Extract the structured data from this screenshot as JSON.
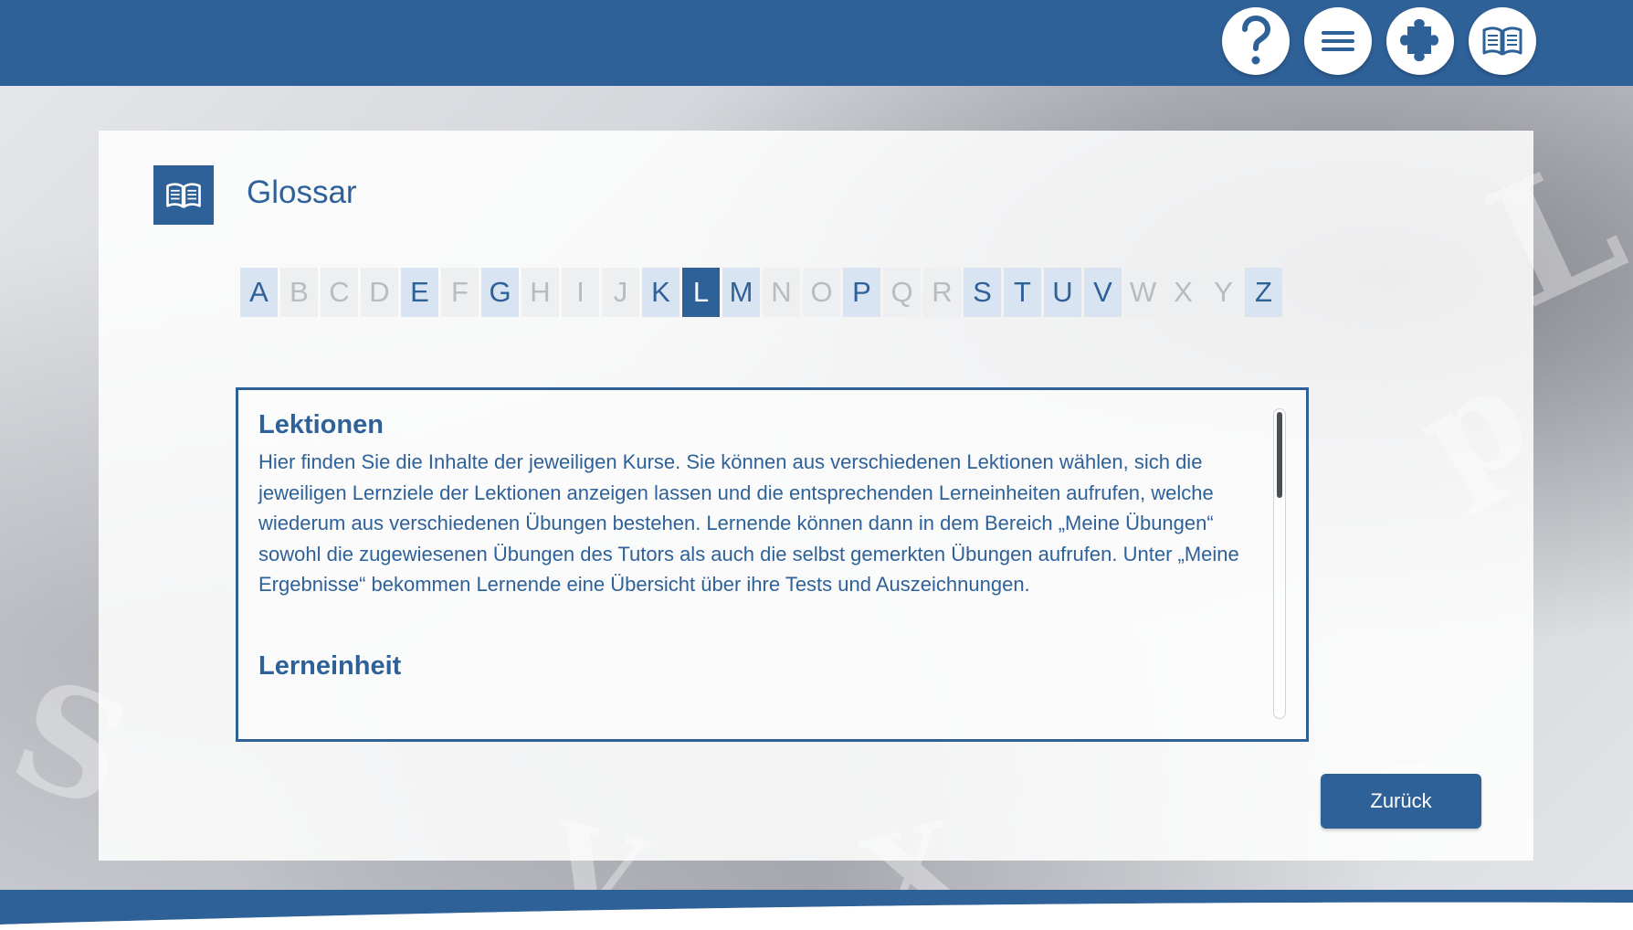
{
  "header": {
    "buttons": [
      {
        "name": "help",
        "icon": "question-mark-icon"
      },
      {
        "name": "menu",
        "icon": "hamburger-menu-icon"
      },
      {
        "name": "puzzle",
        "icon": "puzzle-piece-icon"
      },
      {
        "name": "glossary",
        "icon": "open-book-icon"
      }
    ],
    "background_color": "#2f6199"
  },
  "panel": {
    "icon": "open-book-icon",
    "title": "Glossar"
  },
  "alphabet": {
    "letters": [
      {
        "letter": "A",
        "state": "active"
      },
      {
        "letter": "B",
        "state": "disabled"
      },
      {
        "letter": "C",
        "state": "disabled"
      },
      {
        "letter": "D",
        "state": "disabled"
      },
      {
        "letter": "E",
        "state": "active"
      },
      {
        "letter": "F",
        "state": "disabled"
      },
      {
        "letter": "G",
        "state": "active"
      },
      {
        "letter": "H",
        "state": "disabled"
      },
      {
        "letter": "I",
        "state": "disabled"
      },
      {
        "letter": "J",
        "state": "disabled"
      },
      {
        "letter": "K",
        "state": "active"
      },
      {
        "letter": "L",
        "state": "selected"
      },
      {
        "letter": "M",
        "state": "active"
      },
      {
        "letter": "N",
        "state": "disabled"
      },
      {
        "letter": "O",
        "state": "disabled"
      },
      {
        "letter": "P",
        "state": "active"
      },
      {
        "letter": "Q",
        "state": "disabled"
      },
      {
        "letter": "R",
        "state": "disabled"
      },
      {
        "letter": "S",
        "state": "active"
      },
      {
        "letter": "T",
        "state": "active"
      },
      {
        "letter": "U",
        "state": "active"
      },
      {
        "letter": "V",
        "state": "active"
      },
      {
        "letter": "W",
        "state": "disabled"
      },
      {
        "letter": "X",
        "state": "disabled"
      },
      {
        "letter": "Y",
        "state": "disabled"
      },
      {
        "letter": "Z",
        "state": "active"
      }
    ]
  },
  "entries": [
    {
      "title": "Lektionen",
      "text": "Hier finden Sie die Inhalte der jeweiligen Kurse. Sie können aus verschiedenen Lektionen wählen, sich die jeweiligen Lernziele der Lektionen anzeigen lassen und die entsprechenden Lerneinheiten aufrufen, welche wiederum aus verschiedenen Übungen bestehen. Lernende können dann in dem Bereich „Meine Übungen“ sowohl die zugewiesenen Übungen des Tutors als auch die selbst gemerkten Übungen aufrufen. Unter „Meine Ergebnisse“ bekommen Lernende eine Übersicht über ihre Tests und Auszeichnungen."
    },
    {
      "title": "Lerneinheit",
      "text": ""
    }
  ],
  "footer": {
    "back_label": "Zurück"
  },
  "colors": {
    "primary": "#2f6199",
    "letter_active_bg": "#d9e4f3",
    "letter_disabled_bg": "#eeeff1",
    "letter_disabled_text": "#b9bbbf"
  }
}
